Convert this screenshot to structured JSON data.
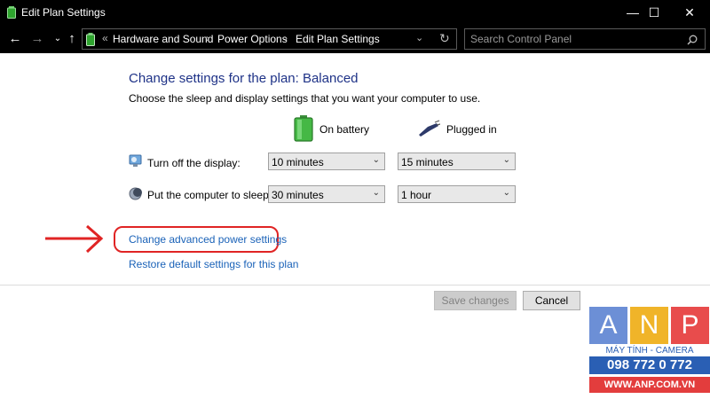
{
  "window": {
    "title": "Edit Plan Settings"
  },
  "nav": {
    "breadcrumbs": [
      "Hardware and Sound",
      "Power Options",
      "Edit Plan Settings"
    ],
    "search_placeholder": "Search Control Panel"
  },
  "main": {
    "heading": "Change settings for the plan: Balanced",
    "subheading": "Choose the sleep and display settings that you want your computer to use.",
    "col_battery": "On battery",
    "col_plugged": "Plugged in",
    "rows": [
      {
        "label": "Turn off the display:",
        "battery": "10 minutes",
        "plugged": "15 minutes"
      },
      {
        "label": "Put the computer to sleep:",
        "battery": "30 minutes",
        "plugged": "1 hour"
      }
    ],
    "advanced_link": "Change advanced power settings",
    "restore_link": "Restore default settings for this plan"
  },
  "buttons": {
    "save": "Save changes",
    "cancel": "Cancel"
  },
  "watermark": {
    "letters": [
      "A",
      "N",
      "P"
    ],
    "tagline": "MÁY TÍNH - CAMERA",
    "phone": "098 772 0 772",
    "website": "WWW.ANP.COM.VN"
  },
  "colors": {
    "heading": "#1e3287",
    "link": "#1a62b8",
    "annotation": "#e02424"
  }
}
